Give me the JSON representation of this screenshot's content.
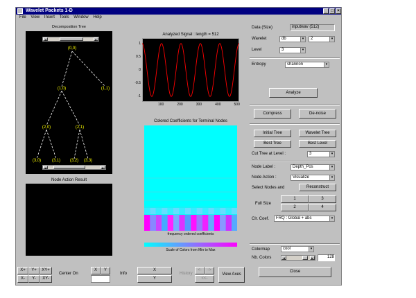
{
  "window": {
    "title": "Wavelet Packets 1-D",
    "min": "_",
    "max": "□",
    "close": "×"
  },
  "menu": [
    "File",
    "View",
    "Insert",
    "Tools",
    "Window",
    "Help"
  ],
  "decomposition_tree": {
    "title": "Decomposition Tree",
    "nodes": [
      "(0,0)",
      "(1,0)",
      "(1,1)",
      "(2,0)",
      "(2,1)",
      "(3,0)",
      "(3,1)",
      "(3,2)",
      "(3,3)"
    ]
  },
  "node_action": {
    "title": "Node Action Result"
  },
  "signal_plot": {
    "title": "Analyzed Signal : length = 512",
    "chart_data": {
      "type": "line",
      "title": "Analyzed Signal : length = 512",
      "x_ticks": [
        100,
        200,
        300,
        400,
        500
      ],
      "y_ticks": [
        1,
        0.5,
        0,
        -0.5,
        -1
      ],
      "xlim": [
        1,
        512
      ],
      "ylim": [
        -1.1,
        1.1
      ],
      "series": [
        {
          "cycles": 5,
          "amplitude": 1,
          "color": "#ff0000"
        }
      ]
    }
  },
  "coef_panel": {
    "title": "Colored Coefficients for Terminal Nodes",
    "caption": "frequency ordered coefficients",
    "scale_caption": "Scale of Colors from Min to Max"
  },
  "right": {
    "data_label": "Data (Size)",
    "data_value": "inputwav (512)",
    "wavelet_label": "Wavelet",
    "wavelet_family": "db",
    "wavelet_number": "2",
    "level_label": "Level",
    "level_value": "3",
    "entropy_label": "Entropy",
    "entropy_value": "shannon",
    "analyze": "Analyze",
    "compress": "Compress",
    "denoise": "De-noise",
    "initial_tree": "Initial Tree",
    "wavelet_tree": "Wavelet Tree",
    "best_tree": "Best Tree",
    "best_level": "Best Level",
    "cut_tree_label": "Cut Tree at Level :",
    "cut_tree_value": "3",
    "node_label_label": "Node Label :",
    "node_label_value": "Depth_Pos",
    "node_action_label": "Node Action :",
    "node_action_value": "Visualize",
    "select_nodes": "Select Nodes and",
    "reconstruct": "Reconstruct",
    "full_size_label": "Full Size",
    "fs1": "1",
    "fs2": "2",
    "fs3": "3",
    "fs4": "4",
    "clr_label": "Clr. Coef.",
    "clr_value": "FRQ : Global + abs",
    "colormap_label": "Colormap",
    "colormap_value": "cool",
    "nbcolors_label": "Nb. Colors",
    "nbcolors_value": "128",
    "close": "Close"
  },
  "bottom": {
    "xplus": "X+",
    "yplus": "Y+",
    "xyplus": "XY+",
    "xminus": "X-",
    "yminus": "Y-",
    "xyminus": "XY-",
    "center_on": "Center On",
    "cx": "X",
    "cy": "Y",
    "info": "Info",
    "ix": "X",
    "iy": "Y",
    "history": "History",
    "hl": "<-",
    "hr": "->",
    "hll": "<<-",
    "view_axes": "View Axes"
  }
}
